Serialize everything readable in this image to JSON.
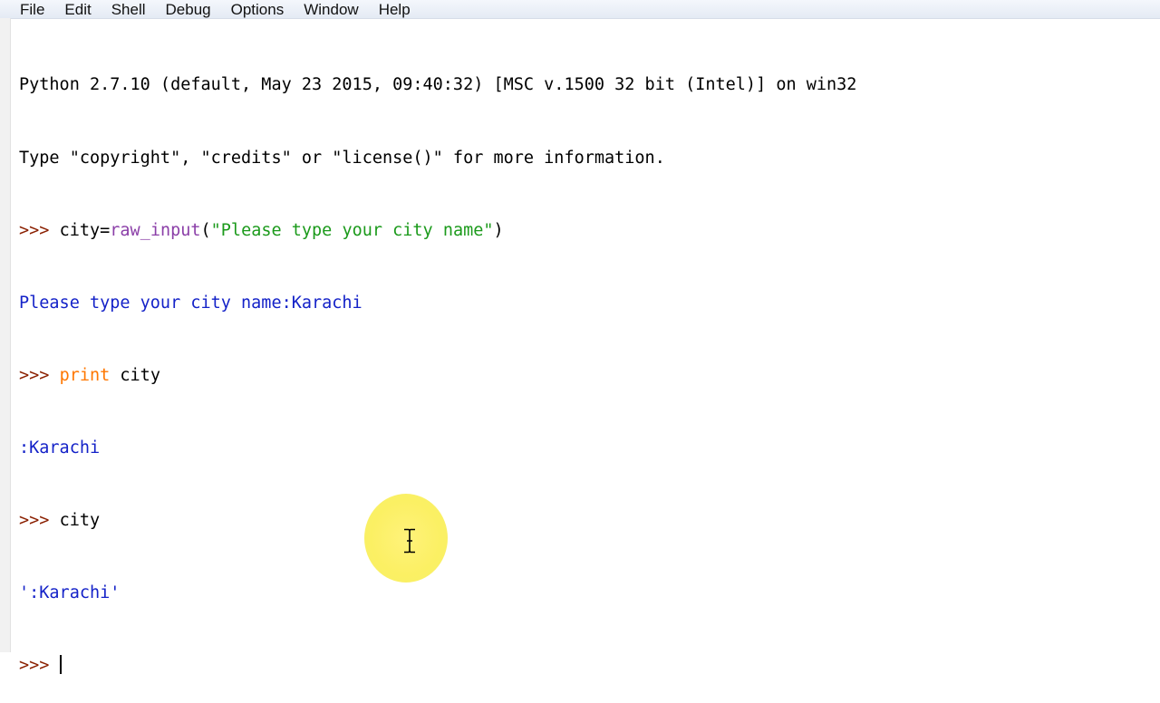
{
  "menubar": {
    "items": [
      "File",
      "Edit",
      "Shell",
      "Debug",
      "Options",
      "Window",
      "Help"
    ]
  },
  "shell": {
    "banner_line1": "Python 2.7.10 (default, May 23 2015, 09:40:32) [MSC v.1500 32 bit (Intel)] on win32",
    "banner_line2": "Type \"copyright\", \"credits\" or \"license()\" for more information.",
    "prompt": ">>> ",
    "cmd1": {
      "var": "city=",
      "func": "raw_input",
      "open": "(",
      "arg": "\"Please type your city name\"",
      "close": ")"
    },
    "out1": "Please type your city name:Karachi",
    "cmd2": {
      "keyword": "print",
      "rest": " city"
    },
    "out2": ":Karachi",
    "cmd3": "city",
    "out3": "':Karachi'"
  },
  "colors": {
    "prompt": "#8a1f00",
    "builtin": "#8b3fa8",
    "string": "#1b9a1b",
    "stdout": "#1422c8",
    "keyword": "#ff7700",
    "cursor_highlight": "#fbf063"
  },
  "icons": {
    "mouse_cursor": "i-beam-cursor-icon"
  }
}
